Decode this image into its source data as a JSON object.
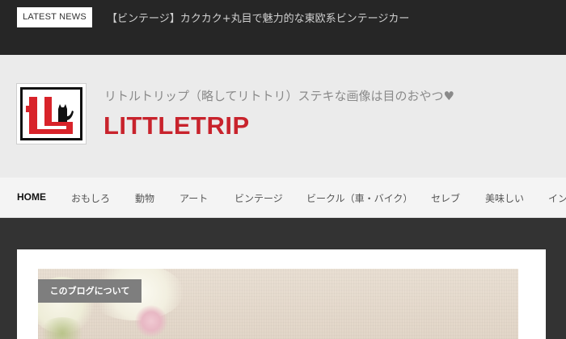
{
  "topbar": {
    "latest_news_label": "LATEST NEWS",
    "ticker_text": "【ビンテージ】カクカク+丸目で魅力的な東欧系ビンテージカー"
  },
  "header": {
    "tagline": "リトルトリップ（略してリトトリ）ステキな画像は目のおやつ♥",
    "site_title": "LITTLETRIP",
    "logo_icon": "littletrip-logo-icon",
    "colors": {
      "title": "#c8232c",
      "logo_red": "#d8232a"
    }
  },
  "nav": {
    "items": [
      {
        "label": "HOME"
      },
      {
        "label": "おもしろ"
      },
      {
        "label": "動物"
      },
      {
        "label": "アート"
      },
      {
        "label": "ビンテージ"
      },
      {
        "label": "ビークル（車・バイク）"
      },
      {
        "label": "セレブ"
      },
      {
        "label": "美味しい"
      },
      {
        "label": "イン"
      }
    ]
  },
  "content": {
    "category_badge": "このブログについて"
  }
}
